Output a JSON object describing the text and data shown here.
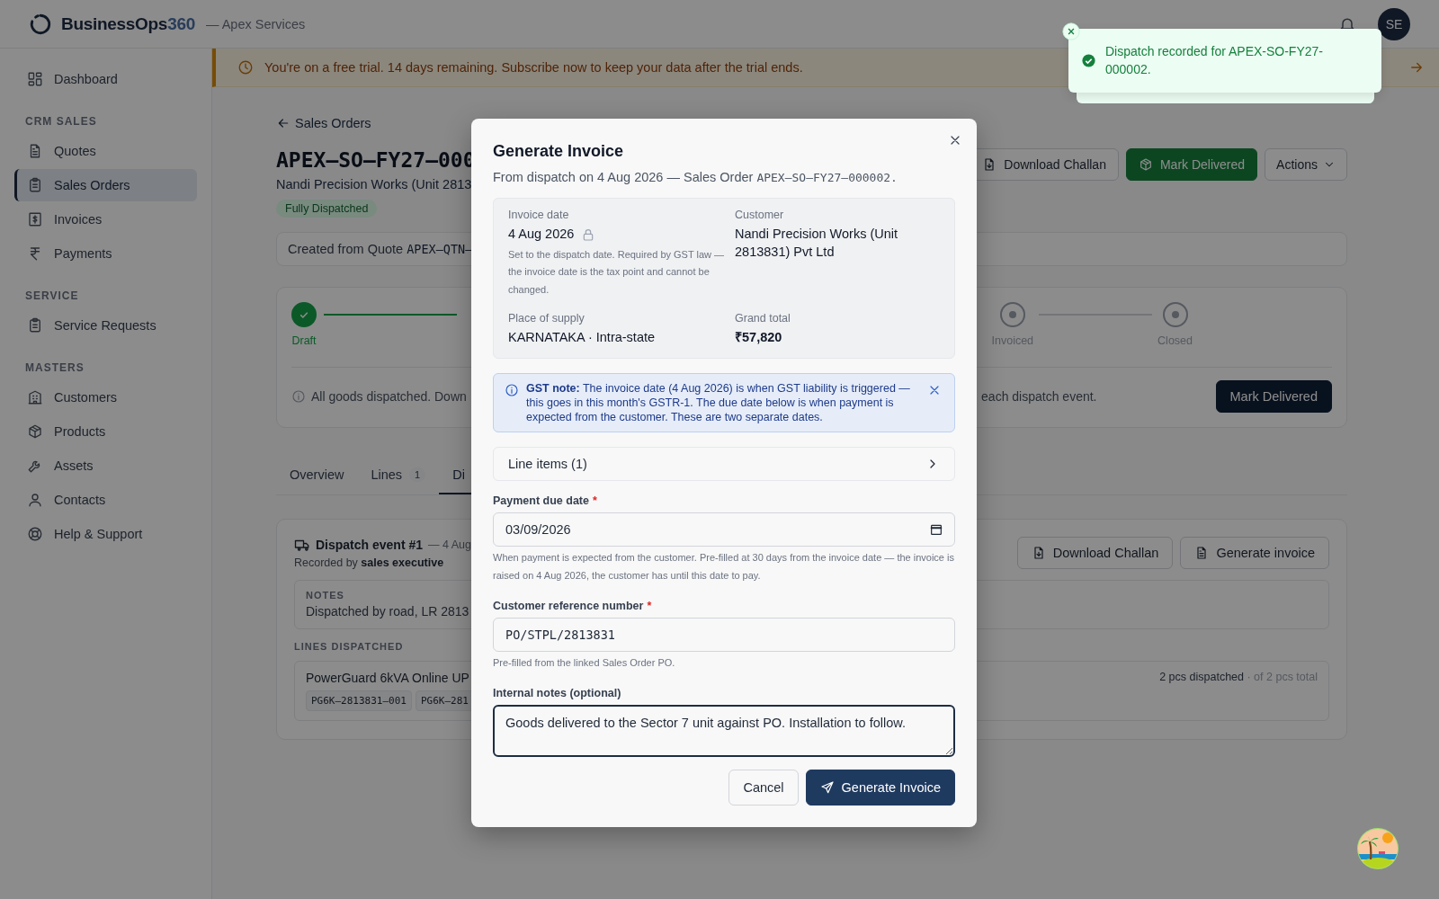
{
  "header": {
    "brand": "BusinessOps",
    "brand_accent": "360",
    "org": "— Apex Services",
    "avatar": "SE"
  },
  "sidebar": {
    "groups": [
      {
        "items": [
          {
            "label": "Dashboard",
            "selected": false
          }
        ]
      },
      {
        "heading": "CRM SALES",
        "items": [
          {
            "label": "Quotes",
            "selected": false
          },
          {
            "label": "Sales Orders",
            "selected": true
          },
          {
            "label": "Invoices",
            "selected": false
          },
          {
            "label": "Payments",
            "selected": false
          }
        ]
      },
      {
        "heading": "SERVICE",
        "items": [
          {
            "label": "Service Requests",
            "selected": false
          }
        ]
      },
      {
        "heading": "MASTERS",
        "items": [
          {
            "label": "Customers",
            "selected": false
          },
          {
            "label": "Products",
            "selected": false
          },
          {
            "label": "Assets",
            "selected": false
          },
          {
            "label": "Contacts",
            "selected": false
          }
        ]
      },
      {
        "items": [
          {
            "label": "Help & Support",
            "selected": false
          }
        ]
      }
    ]
  },
  "banner": {
    "text": "You're on a free trial. 14 days remaining. Subscribe now to keep your data after the trial ends."
  },
  "order": {
    "back_link": "Sales Orders",
    "number": "APEX–SO–FY27–000",
    "customer": "Nandi Precision Works (Unit 2813",
    "status": "Fully Dispatched",
    "source": {
      "text": "Created from Quote",
      "reference": "APEX–QTN–"
    },
    "actions": [
      {
        "label": "Download Challan",
        "kind": "outline"
      },
      {
        "label": "Mark Delivered",
        "kind": "success"
      },
      {
        "label": "Actions",
        "kind": "menu"
      }
    ]
  },
  "stepper": {
    "steps": [
      {
        "label": "Draft",
        "done": true
      },
      {
        "label": "Invoiced",
        "done": false
      },
      {
        "label": "Closed",
        "done": false
      }
    ],
    "note": "All goods dispatched. Down",
    "note_end": "each dispatch event.",
    "button": "Mark Delivered"
  },
  "tabs": [
    {
      "label": "Overview",
      "selected": false
    },
    {
      "label": "Lines",
      "count": "1",
      "selected": false
    },
    {
      "label": "Di",
      "selected": true
    }
  ],
  "dispatch": {
    "title": "Dispatch event #1",
    "date": "— 4 Aug",
    "recorded": "Recorded by **sales executive**",
    "buttons": [
      {
        "label": "Download Challan",
        "kind": "download"
      },
      {
        "label": "Generate invoice",
        "kind": "document"
      }
    ],
    "notes_label": "NOTES",
    "notes": "Dispatched by road, LR 2813",
    "lines_label": "LINES DISPATCHED",
    "lines": [
      {
        "product": "PowerGuard 6kVA Online UP",
        "serials": [
          "PG6K–2813831–001",
          "PG6K–281"
        ],
        "quantity": "2 pcs dispatched",
        "total": "· of 2 pcs total"
      }
    ]
  },
  "modal": {
    "title": "Generate Invoice",
    "subtitle": {
      "text": "From dispatch on 4 Aug 2026 — Sales Order",
      "reference": "APEX–SO–FY27–000002."
    },
    "summary": [
      {
        "label": "Invoice date",
        "value": "4 Aug 2026",
        "locked": true,
        "emphasis": false,
        "help": "Set to the dispatch date. Required by GST law — the invoice date is the tax point and cannot be changed."
      },
      {
        "label": "Customer",
        "value": "Nandi Precision Works (Unit 2813831) Pvt Ltd",
        "locked": false,
        "emphasis": false
      },
      {
        "label": "Place of supply",
        "value": "KARNATAKA · Intra-state",
        "locked": false,
        "emphasis": false
      },
      {
        "label": "Grand total",
        "value": "₹57,820",
        "locked": false,
        "emphasis": true
      }
    ],
    "note": "**GST note:** The invoice date (4 Aug 2026) is when GST liability is triggered — this goes in this month's GSTR-1. The due date below is when payment is expected from the customer. These are two separate dates.",
    "line_items": {
      "label": "Line items (1)",
      "expanded": false
    },
    "fields": [
      {
        "kind": "date",
        "label": "Payment due date",
        "marker": "*",
        "value": "03/09/2026",
        "help": "When payment is expected from the customer. Pre-filled at 30 days from the invoice date — the invoice is raised on 4 Aug 2026, the customer has until this date to pay."
      },
      {
        "kind": "code",
        "label": "Customer reference number",
        "marker": "*",
        "value": "PO/STPL/2813831",
        "help": "Pre-filled from the linked Sales Order PO."
      },
      {
        "kind": "textarea",
        "label": "Internal notes (optional)",
        "focused": true,
        "value": "Goods delivered to the Sector 7 unit against PO. Installation to follow."
      }
    ],
    "cancel": "Cancel",
    "submit": "Generate Invoice"
  },
  "toast": {
    "kind": "success",
    "text": "Dispatch recorded for APEX-SO-FY27-000002."
  }
}
